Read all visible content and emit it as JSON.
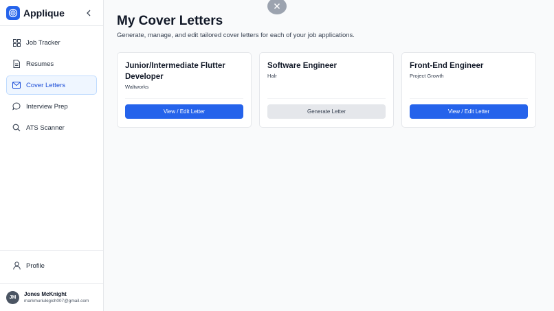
{
  "app": {
    "name": "Applique"
  },
  "sidebar": {
    "items": [
      {
        "label": "Job Tracker",
        "icon": "grid-icon",
        "active": false
      },
      {
        "label": "Resumes",
        "icon": "document-icon",
        "active": false
      },
      {
        "label": "Cover Letters",
        "icon": "mail-icon",
        "active": true
      },
      {
        "label": "Interview Prep",
        "icon": "chat-icon",
        "active": false
      },
      {
        "label": "ATS Scanner",
        "icon": "search-icon",
        "active": false
      }
    ],
    "profile_label": "Profile"
  },
  "user": {
    "initials": "JM",
    "name": "Jones McKnight",
    "email": "markmuriukigich007@gmail.com"
  },
  "main": {
    "title": "My Cover Letters",
    "subtitle": "Generate, manage, and edit tailored cover letters for each of your job applications.",
    "cards": [
      {
        "title": "Junior/Intermediate Flutter Developer",
        "company": "Waltworks",
        "button": "View / Edit Letter"
      },
      {
        "title": "Software Engineer",
        "company": "Halr",
        "button": "Generate Letter"
      },
      {
        "title": "Front-End Engineer",
        "company": "Project Growth",
        "button": "View / Edit Letter"
      }
    ]
  },
  "colors": {
    "accent": "#2563eb",
    "active_bg": "#eff6ff",
    "secondary_btn": "#e5e7eb"
  }
}
